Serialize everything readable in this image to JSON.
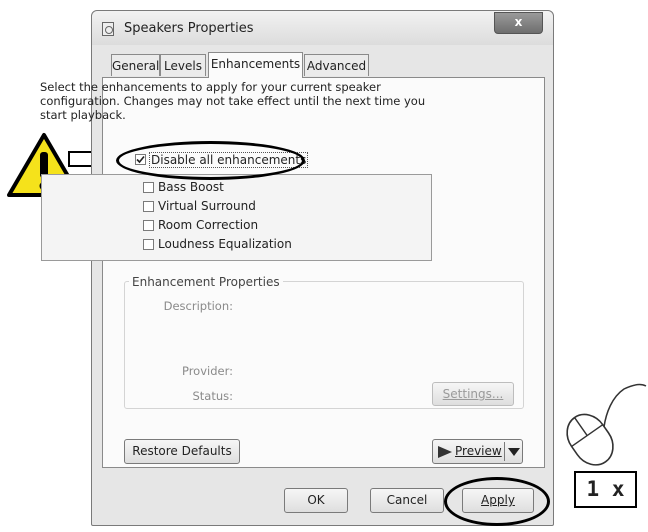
{
  "dialog": {
    "title": "Speakers Properties",
    "close_label": "x",
    "tabs": [
      {
        "label": "General"
      },
      {
        "label": "Levels"
      },
      {
        "label": "Enhancements"
      },
      {
        "label": "Advanced"
      }
    ],
    "active_tab": "Enhancements",
    "description": "Select the enhancements to apply for your current speaker configuration. Changes may not take effect until the next time you start playback.",
    "disable_all": {
      "label": "Disable all enhancements",
      "checked": true
    },
    "enhancements": [
      {
        "label": "Bass Boost",
        "checked": false
      },
      {
        "label": "Virtual Surround",
        "checked": false
      },
      {
        "label": "Room Correction",
        "checked": false
      },
      {
        "label": "Loudness Equalization",
        "checked": false
      }
    ],
    "properties": {
      "group_title": "Enhancement Properties",
      "description_label": "Description:",
      "provider_label": "Provider:",
      "status_label": "Status:",
      "settings_button": "Settings..."
    },
    "restore_defaults": "Restore Defaults",
    "preview": "Preview",
    "ok": "OK",
    "cancel": "Cancel",
    "apply": "Apply"
  },
  "annotations": {
    "click_count": "1 x",
    "icons": [
      "warning-icon",
      "arrow-right-icon",
      "mouse-icon"
    ],
    "warning_color": "#f5e21b"
  }
}
